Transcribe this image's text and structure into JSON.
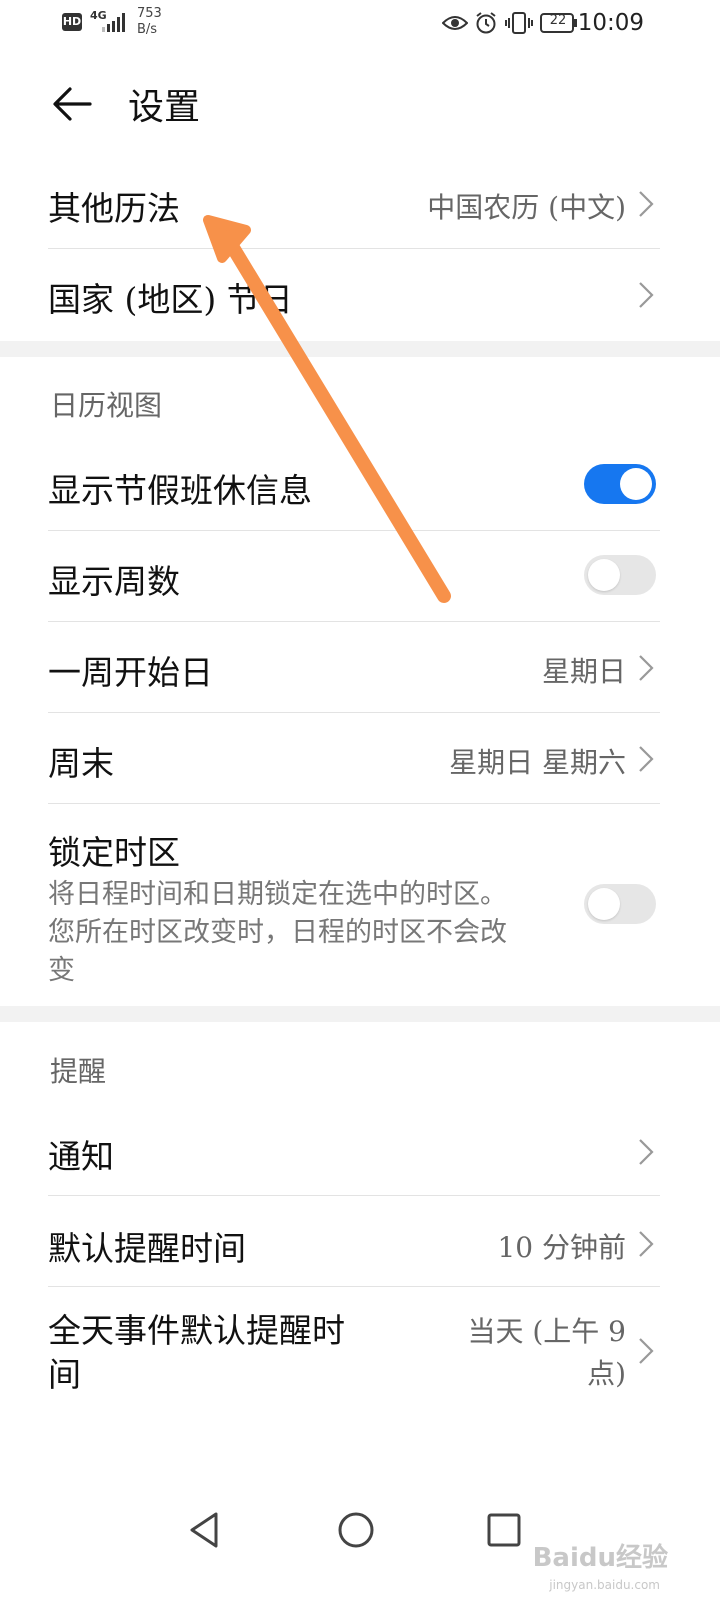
{
  "status_bar": {
    "hd_label": "HD",
    "network_label": "4G",
    "speed_value": "753",
    "speed_unit": "B/s",
    "battery_level": "22",
    "time": "10:09"
  },
  "header": {
    "title": "设置",
    "back_icon": "arrow-left-icon"
  },
  "rows_top": [
    {
      "label": "其他历法",
      "value": "中国农历 (中文)"
    },
    {
      "label": "国家 (地区) 节日",
      "value": ""
    }
  ],
  "calendar_view": {
    "header": "日历视图",
    "show_holidays": {
      "label": "显示节假班休信息",
      "on": true
    },
    "show_week_numbers": {
      "label": "显示周数",
      "on": false
    },
    "week_start": {
      "label": "一周开始日",
      "value": "星期日"
    },
    "weekend": {
      "label": "周末",
      "value": "星期日 星期六"
    },
    "lock_timezone": {
      "label": "锁定时区",
      "description": "将日程时间和日期锁定在选中的时区。您所在时区改变时，日程的时区不会改变",
      "on": false
    }
  },
  "reminders": {
    "header": "提醒",
    "notifications": {
      "label": "通知",
      "value": ""
    },
    "default_reminder": {
      "label": "默认提醒时间",
      "value": "10 分钟前"
    },
    "all_day_reminder": {
      "label_line1": "全天事件默认提醒时",
      "label_line2": "间",
      "value_line1": "当天 (上午 9",
      "value_line2": "点)"
    }
  },
  "nav_bar": {
    "back_icon": "triangle-back-icon",
    "home_icon": "circle-home-icon",
    "recents_icon": "square-recents-icon"
  },
  "watermark": {
    "text": "Baidu经验",
    "sub": "jingyan.baidu.com"
  },
  "colors": {
    "accent": "#1677f0",
    "arrow": "#f7914a",
    "divider": "#e3e3e3",
    "section_gap": "#f2f2f2"
  }
}
